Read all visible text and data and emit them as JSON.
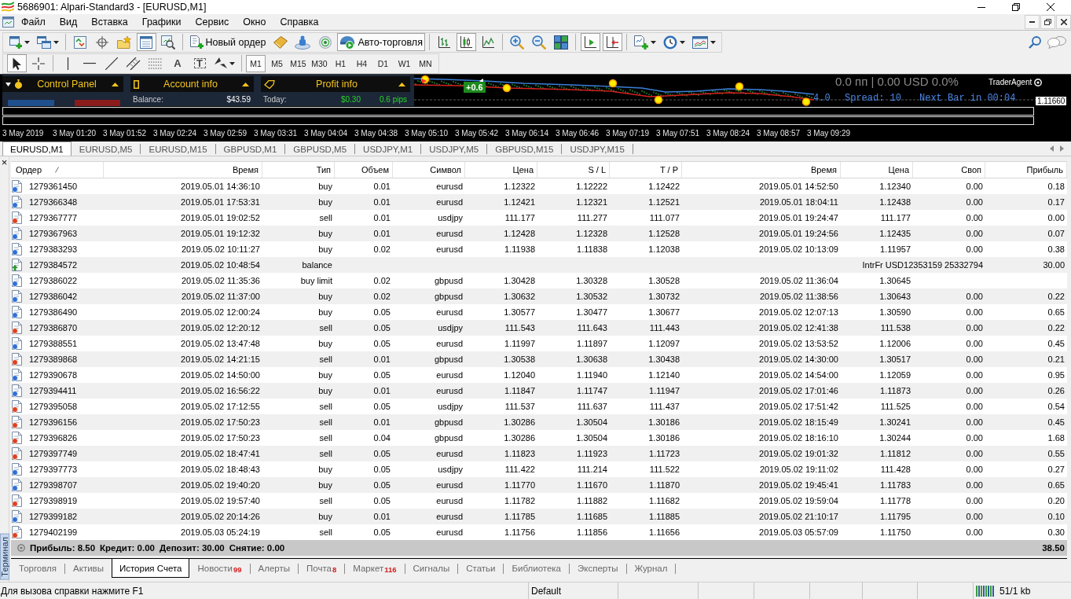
{
  "window": {
    "title": "5686901: Alpari-Standard3 - [EURUSD,M1]"
  },
  "menu": [
    "Файл",
    "Вид",
    "Вставка",
    "Графики",
    "Сервис",
    "Окно",
    "Справка"
  ],
  "toolbar": [
    [
      {
        "kind": "newchart",
        "pressed": false,
        "dropdown": true
      },
      {
        "kind": "profiles",
        "pressed": false,
        "dropdown": true
      }
    ],
    [
      {
        "kind": "market",
        "pressed": false
      },
      {
        "kind": "navigator",
        "pressed": false
      },
      {
        "kind": "favorites",
        "pressed": false
      },
      {
        "kind": "terminal",
        "pressed": true
      },
      {
        "kind": "tester",
        "pressed": false
      }
    ],
    [
      {
        "kind": "order",
        "label": "Новый ордер",
        "pressed": false
      },
      {
        "kind": "editor",
        "pressed": false
      },
      {
        "kind": "cloud",
        "pressed": false
      },
      {
        "kind": "signals",
        "pressed": false
      },
      {
        "kind": "autotrade",
        "label": "Авто-торговля",
        "pressed": true
      }
    ],
    [
      {
        "kind": "bars",
        "pressed": false
      },
      {
        "kind": "candles",
        "pressed": true
      },
      {
        "kind": "line",
        "pressed": false
      }
    ],
    [
      {
        "kind": "zoomin",
        "pressed": false
      },
      {
        "kind": "zoomout",
        "pressed": false
      },
      {
        "kind": "tile",
        "pressed": false
      }
    ],
    [
      {
        "kind": "autoscroll",
        "pressed": true
      },
      {
        "kind": "shift",
        "pressed": true
      }
    ],
    [
      {
        "kind": "indicators",
        "pressed": false,
        "dropdown": true
      },
      {
        "kind": "periods",
        "pressed": false,
        "dropdown": true
      },
      {
        "kind": "templates",
        "pressed": false,
        "dropdown": true
      }
    ]
  ],
  "drawing_toolbar": [
    [
      {
        "kind": "cursor",
        "pressed": true
      },
      {
        "kind": "crosshair",
        "pressed": false
      }
    ],
    [
      {
        "kind": "vline",
        "pressed": false
      },
      {
        "kind": "hline",
        "pressed": false
      },
      {
        "kind": "trend",
        "pressed": false
      },
      {
        "kind": "channel",
        "pressed": false
      },
      {
        "kind": "fibo",
        "pressed": false
      },
      {
        "kind": "text",
        "glyph": "A",
        "pressed": false
      },
      {
        "kind": "label",
        "glyph": "T",
        "pressed": false
      },
      {
        "kind": "arrows",
        "pressed": false,
        "dropdown": true
      }
    ]
  ],
  "timeframes": [
    {
      "label": "M1",
      "selected": true
    },
    {
      "label": "M5",
      "selected": false
    },
    {
      "label": "M15",
      "selected": false
    },
    {
      "label": "M30",
      "selected": false
    },
    {
      "label": "H1",
      "selected": false
    },
    {
      "label": "H4",
      "selected": false
    },
    {
      "label": "D1",
      "selected": false
    },
    {
      "label": "W1",
      "selected": false
    },
    {
      "label": "MN",
      "selected": false
    }
  ],
  "chart": {
    "panels": [
      {
        "kind": "control",
        "title": "Control Panel"
      },
      {
        "kind": "account",
        "title": "Account info",
        "label": "Balance:",
        "values": [
          "$43.59"
        ]
      },
      {
        "kind": "profit",
        "title": "Profit info",
        "label": "Today:",
        "values": [
          "$0.30",
          "0.6 pips"
        ]
      }
    ],
    "trade_label": "+0.6",
    "summary": "0.0 пп | 0.00 USD 0.0%",
    "brand": "TraderAgent",
    "stats": [
      "4.0",
      "Spread: 10",
      "Next Bar in 00:04"
    ],
    "price": "1.11660",
    "time_labels": [
      "3 May 2019",
      "3 May 01:20",
      "3 May 01:52",
      "3 May 02:24",
      "3 May 02:59",
      "3 May 03:31",
      "3 May 04:04",
      "3 May 04:38",
      "3 May 05:10",
      "3 May 05:42",
      "3 May 06:14",
      "3 May 06:46",
      "3 May 07:19",
      "3 May 07:51",
      "3 May 08:24",
      "3 May 08:57",
      "3 May 09:29"
    ]
  },
  "chart_tabs": [
    {
      "label": "EURUSD,M1",
      "selected": true
    },
    {
      "label": "EURUSD,M5",
      "selected": false
    },
    {
      "label": "EURUSD,M15",
      "selected": false
    },
    {
      "label": "GBPUSD,M1",
      "selected": false
    },
    {
      "label": "GBPUSD,M5",
      "selected": false
    },
    {
      "label": "USDJPY,M1",
      "selected": false
    },
    {
      "label": "USDJPY,M5",
      "selected": false
    },
    {
      "label": "GBPUSD,M15",
      "selected": false
    },
    {
      "label": "USDJPY,M15",
      "selected": false
    }
  ],
  "terminal": {
    "close": "×",
    "title": "Терминал",
    "columns": [
      {
        "label": "Ордер",
        "sorted": true
      },
      {
        "label": "Время",
        "sorted": false
      },
      {
        "label": "Тип",
        "sorted": false
      },
      {
        "label": "Объем",
        "sorted": false
      },
      {
        "label": "Символ",
        "sorted": false
      },
      {
        "label": "Цена",
        "sorted": false
      },
      {
        "label": "S / L",
        "sorted": false
      },
      {
        "label": "T / P",
        "sorted": false
      },
      {
        "label": "Время",
        "sorted": false
      },
      {
        "label": "Цена",
        "sorted": false
      },
      {
        "label": "Своп",
        "sorted": false
      },
      {
        "label": "Прибыль",
        "sorted": false
      }
    ],
    "rows": [
      {
        "kind": "buy",
        "cells": [
          "1279361450",
          "2019.05.01 14:36:10",
          "buy",
          "0.01",
          "eurusd",
          "1.12322",
          "1.12222",
          "1.12422",
          "2019.05.01 14:52:50",
          "1.12340",
          "0.00",
          "0.18"
        ]
      },
      {
        "kind": "buy",
        "cells": [
          "1279366348",
          "2019.05.01 17:53:31",
          "buy",
          "0.01",
          "eurusd",
          "1.12421",
          "1.12321",
          "1.12521",
          "2019.05.01 18:04:11",
          "1.12438",
          "0.00",
          "0.17"
        ]
      },
      {
        "kind": "sell",
        "cells": [
          "1279367777",
          "2019.05.01 19:02:52",
          "sell",
          "0.01",
          "usdjpy",
          "111.177",
          "111.277",
          "111.077",
          "2019.05.01 19:24:47",
          "111.177",
          "0.00",
          "0.00"
        ]
      },
      {
        "kind": "buy",
        "cells": [
          "1279367963",
          "2019.05.01 19:12:32",
          "buy",
          "0.01",
          "eurusd",
          "1.12428",
          "1.12328",
          "1.12528",
          "2019.05.01 19:24:56",
          "1.12435",
          "0.00",
          "0.07"
        ]
      },
      {
        "kind": "buy",
        "cells": [
          "1279383293",
          "2019.05.02 10:11:27",
          "buy",
          "0.02",
          "eurusd",
          "1.11938",
          "1.11838",
          "1.12038",
          "2019.05.02 10:13:09",
          "1.11957",
          "0.00",
          "0.38"
        ]
      },
      {
        "kind": "balance",
        "cells": [
          "1279384572",
          "2019.05.02 10:48:54",
          "balance"
        ],
        "comment": "IntrFr USD12353159 25332794",
        "profit": "30.00"
      },
      {
        "kind": "buy",
        "cells": [
          "1279386022",
          "2019.05.02 11:35:36",
          "buy limit",
          "0.02",
          "gbpusd",
          "1.30428",
          "1.30328",
          "1.30528",
          "2019.05.02 11:36:04",
          "1.30645"
        ]
      },
      {
        "kind": "buy",
        "cells": [
          "1279386042",
          "2019.05.02 11:37:00",
          "buy",
          "0.02",
          "gbpusd",
          "1.30632",
          "1.30532",
          "1.30732",
          "2019.05.02 11:38:56",
          "1.30643",
          "0.00",
          "0.22"
        ]
      },
      {
        "kind": "buy",
        "cells": [
          "1279386490",
          "2019.05.02 12:00:24",
          "buy",
          "0.05",
          "eurusd",
          "1.30577",
          "1.30477",
          "1.30677",
          "2019.05.02 12:07:13",
          "1.30590",
          "0.00",
          "0.65"
        ]
      },
      {
        "kind": "sell",
        "cells": [
          "1279386870",
          "2019.05.02 12:20:12",
          "sell",
          "0.05",
          "usdjpy",
          "111.543",
          "111.643",
          "111.443",
          "2019.05.02 12:41:38",
          "111.538",
          "0.00",
          "0.22"
        ]
      },
      {
        "kind": "buy",
        "cells": [
          "1279388551",
          "2019.05.02 13:47:48",
          "buy",
          "0.05",
          "eurusd",
          "1.11997",
          "1.11897",
          "1.12097",
          "2019.05.02 13:53:52",
          "1.12006",
          "0.00",
          "0.45"
        ]
      },
      {
        "kind": "sell",
        "cells": [
          "1279389868",
          "2019.05.02 14:21:15",
          "sell",
          "0.01",
          "gbpusd",
          "1.30538",
          "1.30638",
          "1.30438",
          "2019.05.02 14:30:00",
          "1.30517",
          "0.00",
          "0.21"
        ]
      },
      {
        "kind": "buy",
        "cells": [
          "1279390678",
          "2019.05.02 14:50:00",
          "buy",
          "0.05",
          "eurusd",
          "1.12040",
          "1.11940",
          "1.12140",
          "2019.05.02 14:54:00",
          "1.12059",
          "0.00",
          "0.95"
        ]
      },
      {
        "kind": "buy",
        "cells": [
          "1279394411",
          "2019.05.02 16:56:22",
          "buy",
          "0.01",
          "eurusd",
          "1.11847",
          "1.11747",
          "1.11947",
          "2019.05.02 17:01:46",
          "1.11873",
          "0.00",
          "0.26"
        ]
      },
      {
        "kind": "sell",
        "cells": [
          "1279395058",
          "2019.05.02 17:12:55",
          "sell",
          "0.05",
          "usdjpy",
          "111.537",
          "111.637",
          "111.437",
          "2019.05.02 17:51:42",
          "111.525",
          "0.00",
          "0.54"
        ]
      },
      {
        "kind": "sell",
        "cells": [
          "1279396156",
          "2019.05.02 17:50:23",
          "sell",
          "0.01",
          "gbpusd",
          "1.30286",
          "1.30504",
          "1.30186",
          "2019.05.02 18:15:49",
          "1.30241",
          "0.00",
          "0.45"
        ]
      },
      {
        "kind": "sell",
        "cells": [
          "1279396826",
          "2019.05.02 17:50:23",
          "sell",
          "0.04",
          "gbpusd",
          "1.30286",
          "1.30504",
          "1.30186",
          "2019.05.02 18:16:10",
          "1.30244",
          "0.00",
          "1.68"
        ]
      },
      {
        "kind": "sell",
        "cells": [
          "1279397749",
          "2019.05.02 18:47:41",
          "sell",
          "0.05",
          "eurusd",
          "1.11823",
          "1.11923",
          "1.11723",
          "2019.05.02 19:01:32",
          "1.11812",
          "0.00",
          "0.55"
        ]
      },
      {
        "kind": "buy",
        "cells": [
          "1279397773",
          "2019.05.02 18:48:43",
          "buy",
          "0.05",
          "usdjpy",
          "111.422",
          "111.214",
          "111.522",
          "2019.05.02 19:11:02",
          "111.428",
          "0.00",
          "0.27"
        ]
      },
      {
        "kind": "buy",
        "cells": [
          "1279398707",
          "2019.05.02 19:40:20",
          "buy",
          "0.05",
          "eurusd",
          "1.11770",
          "1.11670",
          "1.11870",
          "2019.05.02 19:45:41",
          "1.11783",
          "0.00",
          "0.65"
        ]
      },
      {
        "kind": "sell",
        "cells": [
          "1279398919",
          "2019.05.02 19:57:40",
          "sell",
          "0.05",
          "eurusd",
          "1.11782",
          "1.11882",
          "1.11682",
          "2019.05.02 19:59:04",
          "1.11778",
          "0.00",
          "0.20"
        ]
      },
      {
        "kind": "buy",
        "cells": [
          "1279399182",
          "2019.05.02 20:14:26",
          "buy",
          "0.01",
          "eurusd",
          "1.11785",
          "1.11685",
          "1.11885",
          "2019.05.02 21:10:17",
          "1.11795",
          "0.00",
          "0.10"
        ]
      },
      {
        "kind": "sell",
        "cells": [
          "1279402199",
          "2019.05.03 05:24:19",
          "sell",
          "0.05",
          "eurusd",
          "1.11756",
          "1.11856",
          "1.11656",
          "2019.05.03 05:57:09",
          "1.11750",
          "0.00",
          "0.30"
        ]
      }
    ],
    "summary": {
      "items": [
        "Прибыль: 8.50",
        "Кредит: 0.00",
        "Депозит: 30.00",
        "Снятие: 0.00"
      ],
      "total": "38.50"
    },
    "tabs": [
      {
        "label": "Торговля",
        "selected": false
      },
      {
        "label": "Активы",
        "selected": false
      },
      {
        "label": "История Счета",
        "selected": true
      },
      {
        "label": "Новости",
        "count": "99",
        "selected": false
      },
      {
        "label": "Алерты",
        "selected": false
      },
      {
        "label": "Почта",
        "count": "8",
        "selected": false
      },
      {
        "label": "Маркет",
        "count": "116",
        "selected": false
      },
      {
        "label": "Сигналы",
        "selected": false
      },
      {
        "label": "Статьи",
        "selected": false
      },
      {
        "label": "Библиотека",
        "selected": false
      },
      {
        "label": "Эксперты",
        "selected": false
      },
      {
        "label": "Журнал",
        "selected": false
      }
    ]
  },
  "status_bar": {
    "help": "Для вызова справки нажмите F1",
    "profile": "Default",
    "traffic": "51/1 kb"
  }
}
